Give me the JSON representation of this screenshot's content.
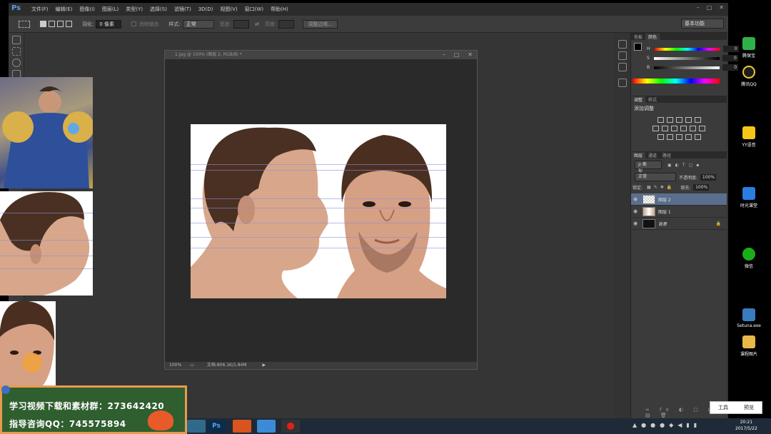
{
  "app": {
    "logo": "Ps",
    "menu": [
      "文件(F)",
      "编辑(E)",
      "图像(I)",
      "图层(L)",
      "类型(Y)",
      "选择(S)",
      "滤镜(T)",
      "3D(D)",
      "视图(V)",
      "窗口(W)",
      "帮助(H)"
    ],
    "window_controls": [
      "–",
      "□",
      "✕"
    ]
  },
  "options": {
    "feather_label": "羽化:",
    "feather_value": "0 像素",
    "antialias_label": "消除锯齿",
    "style_label": "样式:",
    "style_value": "正常",
    "width_label": "宽度:",
    "height_label": "高度:",
    "refine_edge": "调整边缘...",
    "workspace": "基本功能"
  },
  "document": {
    "title": "1.jpg @ 100% (图层 2, RGB/8) *",
    "zoom": "100%",
    "doc_info": "文档:806.1K/1.84M"
  },
  "panels": {
    "color_tab": "颜色",
    "swatches_tab": "色板",
    "h_label": "H",
    "s_label": "S",
    "b_label": "B",
    "h_value": "0",
    "s_value": "0",
    "b_value": "0",
    "adjust_tab": "调整",
    "styles_tab": "样式",
    "add_adjust": "添加调整",
    "layers_tab": "图层",
    "channels_tab": "通道",
    "paths_tab": "路径",
    "kind": "ρ 类型",
    "blend": "正常",
    "opacity_label": "不透明度:",
    "opacity_value": "100%",
    "lock_label": "锁定:",
    "fill_label": "填充:",
    "fill_value": "100%",
    "layers": [
      {
        "name": "图层 2"
      },
      {
        "name": "图层 1"
      },
      {
        "name": "背景"
      }
    ]
  },
  "desktop": {
    "icons": [
      "腾保宝",
      "腾讯QQ",
      "YY语音",
      "时光课堂",
      "微信",
      "Setuna.exe",
      "课程图片"
    ],
    "tools_button": "工具",
    "preview_button": "预览"
  },
  "taskbar": {
    "time": "20:21",
    "date": "2017/5/22"
  },
  "promo": {
    "line1": "学习视频下载和素材群：273642420",
    "line2": "指导咨询QQ：745575894"
  }
}
